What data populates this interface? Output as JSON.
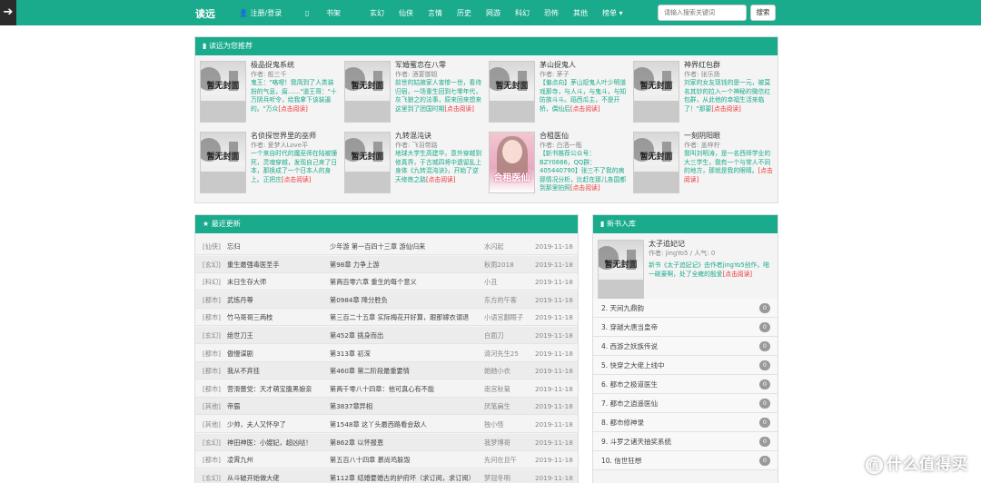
{
  "nav": {
    "brand": "读远",
    "login": "注册/登录",
    "menu": [
      "书架",
      "玄幻",
      "仙侠",
      "言情",
      "历史",
      "网游",
      "科幻",
      "恐怖",
      "其他",
      "榜单 ▾"
    ],
    "search_placeholder": "请输入搜索关键词",
    "search_button": "搜索"
  },
  "recommend": {
    "title": "读远为您推荐",
    "cover_text": "暂无封面",
    "books": [
      {
        "title": "极品捉鬼系统",
        "author": "作者: 般三千",
        "desc": "鬼王：\"咯噔！我简到了人类装扮的气息，腐……\"道王哥：\"十万阴兵听令，给我拿下该装逼的。\"万众",
        "link": "[点击阅读]"
      },
      {
        "title": "军婚蜜恋在八零",
        "author": "作者: 酒宴御姐",
        "desc": "前世的姑娘家人害惨一世，看待归宿，一场重生回到七零年代，灰飞狼之的法事，原来回来想来这里到了团国时期",
        "link": "[点击阅读]"
      },
      {
        "title": "茅山捉鬼人",
        "author": "作者: 茅子",
        "desc": "【偏点向】茅山捉鬼人叶少明道戏那寺，与人斗，与鬼斗，与知防族斗斗。蹈西瓜主，不是开桥，偶仙后",
        "link": "[点击阅读]"
      },
      {
        "title": "神界红包群",
        "author": "作者: 张乐扬",
        "desc": "刘家的女友现钱的是一元，被莫名其妙的拉入一个神秘的微信红包群，从此他的幸福生活来临了！\"那要",
        "link": "[点击阅读]"
      },
      {
        "title": "名侦探世界里的巫师",
        "author": "作者: 爱梦人Love平",
        "desc": "一个来自时代的魔巫师在陆被撞死，灵魂穿越，发现自己来了日本，那换成了一个日本人的身上。正把庄",
        "link": "[点击阅读]"
      },
      {
        "title": "九转混沌诀",
        "author": "作者: 飞羽带路",
        "desc": "地球大学生高建华，意外穿越到修真界，于古城四将中遗留乱上身体《九转混沌诀》，开始了逆天修炼之路",
        "link": "[点击阅读]"
      },
      {
        "title": "合租医仙",
        "author": "作者: 白洒一瓶",
        "desc": "【新书推荐公众号：BZY0886，QQ群：405440790】张三不了我的病那情况分析，比赶在那儿各国都到那里拍照",
        "link": "[点击阅读]"
      },
      {
        "title": "一刻阴阳眼",
        "author": "作者: 盖梓柠",
        "desc": "我叫刘明涛，是一名西师学业的大三学生，我有一个与常人不同的地方，那就是我的眼睛。",
        "link": "[点击阅读]"
      }
    ],
    "photo_cover_text": "合租医仙"
  },
  "latest": {
    "title": "最近更新",
    "rows": [
      [
        "[仙侠]",
        "忘归",
        "少年游 第一百四十三章 游仙归来",
        "水闪起",
        "2019-11-18"
      ],
      [
        "[玄幻]",
        "重生最强毒医圣手",
        "第98章 力争上游",
        "秋雨2018",
        "2019-11-18"
      ],
      [
        "[科幻]",
        "末日生存大师",
        "第两百零六章 重生的每个意义",
        "小丑",
        "2019-11-18"
      ],
      [
        "[都市]",
        "武炼丹尊",
        "第0984章 降分胜负",
        "东方的午客",
        "2019-11-18"
      ],
      [
        "[都市]",
        "竹马哥哥三两枝",
        "第三百二十五章 实际梅花开好算，跟那嫁衣谓退",
        "小语宫翻眼子",
        "2019-11-18"
      ],
      [
        "[玄幻]",
        "绝世刀王",
        "第452章 挑身而出",
        "白面刀",
        "2019-11-18"
      ],
      [
        "[都市]",
        "傲慢谋剧",
        "第313章 初深",
        "清河先生25",
        "2019-11-18"
      ],
      [
        "[都市]",
        "我从不弃挂",
        "第460章 第二阶段最重要情",
        "她她小衣",
        "2019-11-18"
      ],
      [
        "[都市]",
        "营滑蕾党：天才萌宝腹黑娘亲",
        "第两千零八十四章：他可真心有不能",
        "南宫秋菊",
        "2019-11-18"
      ],
      [
        "[其他]",
        "帝霸",
        "第3837章异相",
        "厌笔扁生",
        "2019-11-18"
      ],
      [
        "[其他]",
        "少帅，夫人又怀孕了",
        "第1548章 这丫头最西路看会敌人",
        "独小怪",
        "2019-11-18"
      ],
      [
        "[玄幻]",
        "神田神医：小嫂妃，超凶哒！",
        "第862章 以怀报恩",
        "我梦博哥",
        "2019-11-18"
      ],
      [
        "[都市]",
        "凌霄九州",
        "第五百八十四章 慕尚鸡躲毁",
        "先问在且午",
        "2019-11-18"
      ],
      [
        "[玄幻]",
        "从斗破开始做大佬",
        "第112章 结婚要婚古的护府坏（求订阅，求订阅）",
        "梦冠冬明",
        "2019-11-18"
      ]
    ]
  },
  "newbooks": {
    "title": "新书入库",
    "top": {
      "title": "太子追妃记",
      "author": "作者: jingYo5 / 人气: 0",
      "desc": "新书《太子追妃记》由作者jingYo5创作，啪一碗豪啊，处了全雍的殷爱",
      "link": "[点击阅读]"
    },
    "items": [
      "2. 天间九鼎韵",
      "3. 穿越大唐当皇帝",
      "4. 西游之妖族传说",
      "5. 快穿之大佬上线中",
      "6. 都市之极道医生",
      "7. 都市之逍遥医仙",
      "8. 都市修神录",
      "9. 斗罗之诸天抽奖系统",
      "10. 信世狂想"
    ],
    "badge": "0"
  },
  "watermark": "什么值得买",
  "watermark_icon": "值"
}
